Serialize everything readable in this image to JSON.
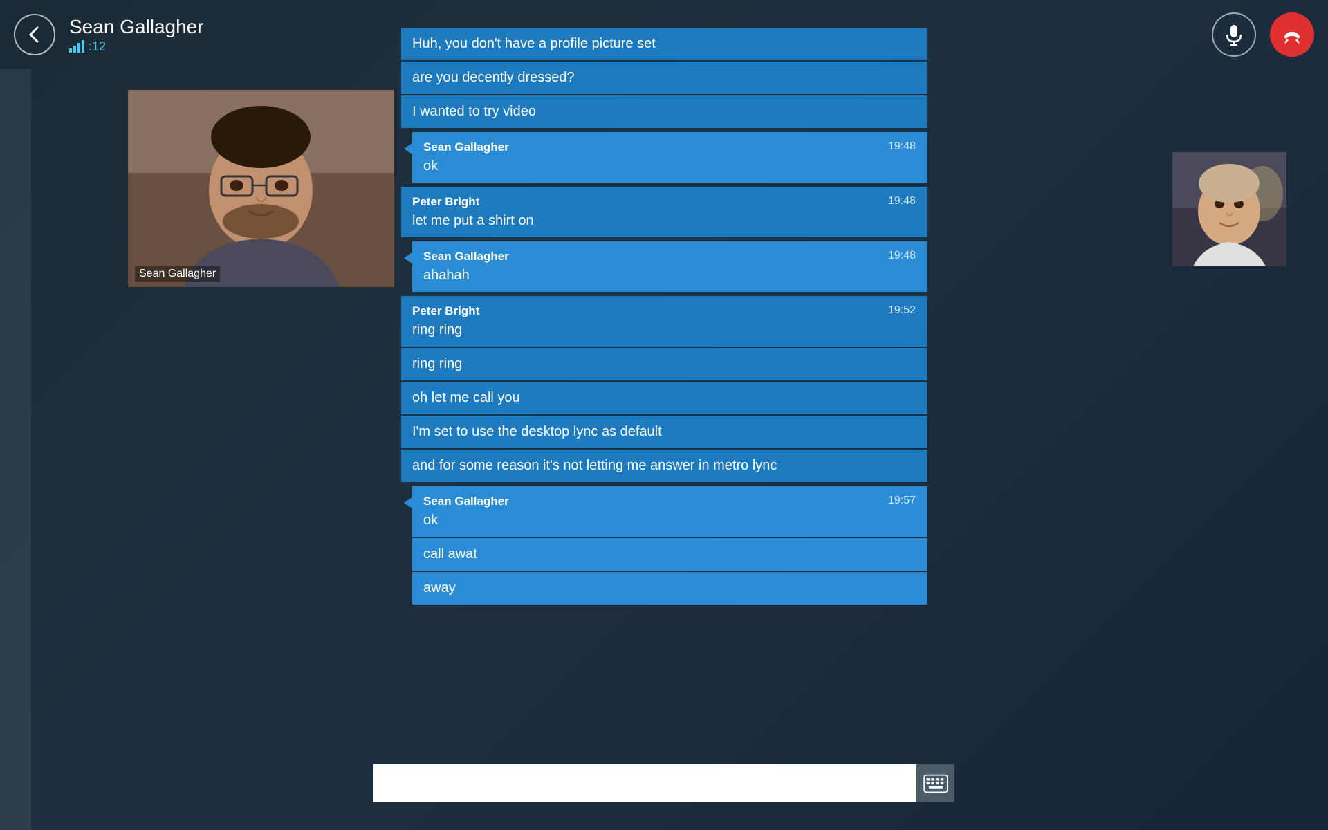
{
  "header": {
    "back_label": "←",
    "contact_name": "Sean Gallagher",
    "contact_status": ":12"
  },
  "chat": {
    "messages": [
      {
        "id": "m1",
        "sender": "peter",
        "type": "cont",
        "text": "Huh, you don't have a profile picture set"
      },
      {
        "id": "m2",
        "sender": "peter",
        "type": "cont",
        "text": "are you decently dressed?"
      },
      {
        "id": "m3",
        "sender": "peter",
        "type": "cont",
        "text": "I wanted to try video"
      },
      {
        "id": "m4",
        "sender": "sean",
        "type": "header",
        "name": "Sean Gallagher",
        "time": "19:48",
        "text": "ok"
      },
      {
        "id": "m5",
        "sender": "peter",
        "type": "header",
        "name": "Peter Bright",
        "time": "19:48",
        "text": "let me put a shirt on"
      },
      {
        "id": "m6",
        "sender": "sean",
        "type": "header",
        "name": "Sean Gallagher",
        "time": "19:48",
        "text": "ahahah"
      },
      {
        "id": "m7",
        "sender": "peter",
        "type": "header",
        "name": "Peter Bright",
        "time": "19:52",
        "text": "ring ring"
      },
      {
        "id": "m8",
        "sender": "peter",
        "type": "cont",
        "text": "ring ring"
      },
      {
        "id": "m9",
        "sender": "peter",
        "type": "cont",
        "text": "oh let me call you"
      },
      {
        "id": "m10",
        "sender": "peter",
        "type": "cont",
        "text": "I'm set to use the desktop lync as default"
      },
      {
        "id": "m11",
        "sender": "peter",
        "type": "cont",
        "text": "and for some reason it's not letting me answer in metro lync"
      },
      {
        "id": "m12",
        "sender": "sean",
        "type": "header",
        "name": "Sean Gallagher",
        "time": "19:57",
        "text": "ok"
      },
      {
        "id": "m13",
        "sender": "sean",
        "type": "cont",
        "text": "call awat"
      },
      {
        "id": "m14",
        "sender": "sean",
        "type": "cont",
        "text": "away"
      }
    ]
  },
  "input": {
    "placeholder": ""
  },
  "video": {
    "sean_label": "Sean Gallagher"
  },
  "icons": {
    "back": "←",
    "mic": "🎤",
    "end_call": "📵",
    "keyboard": "⌨"
  }
}
